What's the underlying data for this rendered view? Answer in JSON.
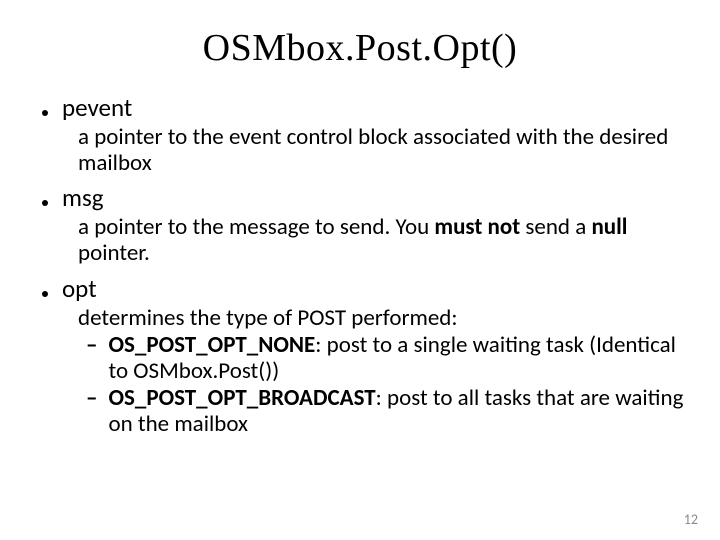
{
  "title": "OSMbox.Post.Opt()",
  "params": {
    "pevent": {
      "name": "pevent",
      "desc": "a pointer to the event control block associated with the desired mailbox"
    },
    "msg": {
      "name": "msg",
      "desc_pre": "a pointer to the message to send.  You ",
      "desc_mustnot": "must not",
      "desc_mid": " send a ",
      "desc_null": "null",
      "desc_post": " pointer."
    },
    "opt": {
      "name": "opt",
      "intro": "determines the type of POST performed:",
      "items": [
        {
          "const": "OS_POST_OPT_NONE",
          "tail": ": post to a single waiting task (Identical to OSMbox.Post())"
        },
        {
          "const": "OS_POST_OPT_BROADCAST",
          "tail": ": post to all tasks that are waiting on the mailbox"
        }
      ]
    }
  },
  "page_number": "12"
}
